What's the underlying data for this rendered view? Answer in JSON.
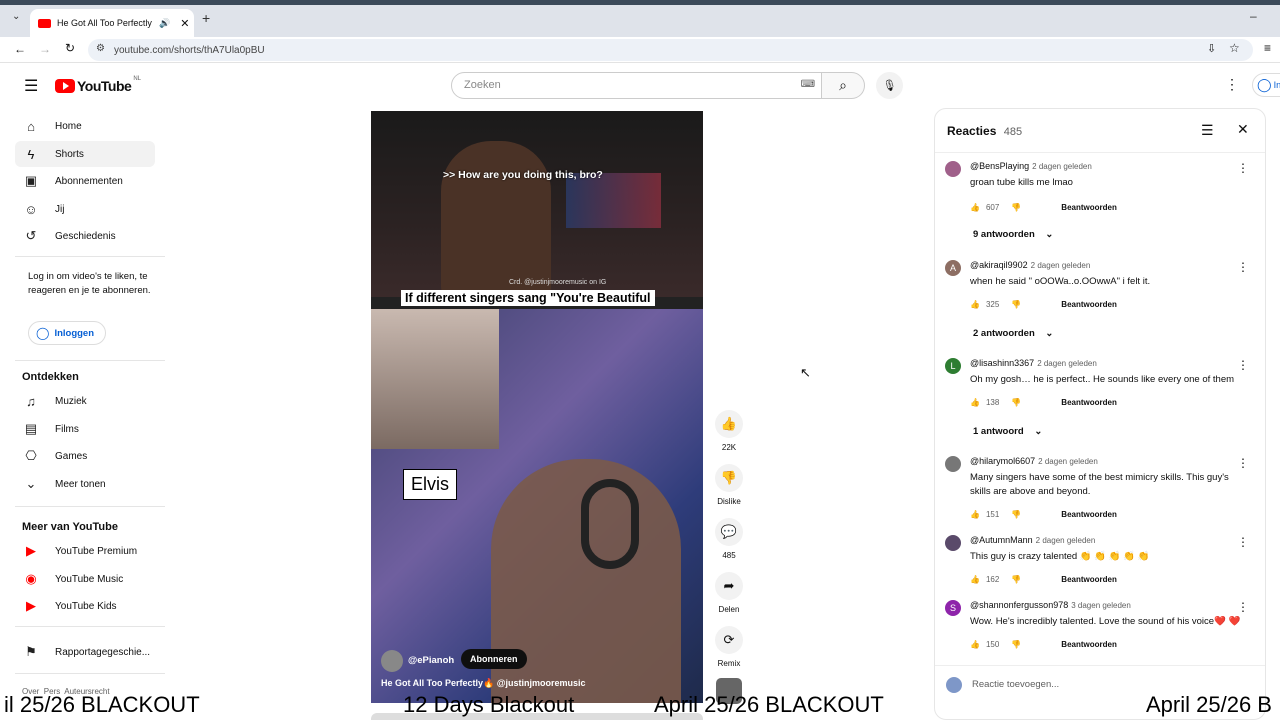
{
  "browser": {
    "tab_title": "He Got All Too Perfectly🔥",
    "url": "youtube.com/shorts/thA7Ula0pBU"
  },
  "header": {
    "logo_text": "YouTube",
    "logo_region": "NL",
    "search_placeholder": "Zoeken",
    "signin_partial": "In"
  },
  "sidebar": {
    "main": [
      {
        "label": "Home",
        "icon": "home-icon"
      },
      {
        "label": "Shorts",
        "icon": "shorts-icon"
      },
      {
        "label": "Abonnementen",
        "icon": "subscriptions-icon"
      },
      {
        "label": "Jij",
        "icon": "you-icon"
      },
      {
        "label": "Geschiedenis",
        "icon": "history-icon"
      }
    ],
    "signin_prompt": "Log in om video's te liken, te reageren en je te abonneren.",
    "signin_button": "Inloggen",
    "explore_heading": "Ontdekken",
    "explore": [
      {
        "label": "Muziek",
        "icon": "music-icon"
      },
      {
        "label": "Films",
        "icon": "films-icon"
      },
      {
        "label": "Games",
        "icon": "games-icon"
      },
      {
        "label": "Meer tonen",
        "icon": "chevron-down-icon"
      }
    ],
    "more_heading": "Meer van YouTube",
    "more": [
      {
        "label": "YouTube Premium"
      },
      {
        "label": "YouTube Music"
      },
      {
        "label": "YouTube Kids"
      }
    ],
    "report": "Rapportagegeschie...",
    "footer": "Over  Pers  Auteursrecht"
  },
  "video": {
    "caption_top": ">> How are you doing this, bro?",
    "credit": "Crd. @justinjmooremusic on IG",
    "banner": "If different singers sang \"You're Beautiful",
    "name_tag": "Elvis",
    "channel": "@ePianoh",
    "subscribe": "Abonneren",
    "title": "He Got All Too Perfectly🔥 @justinjmooremusic"
  },
  "actions": {
    "like_count": "22K",
    "dislike_label": "Dislike",
    "comment_count": "485",
    "share_label": "Delen",
    "remix_label": "Remix"
  },
  "comments": {
    "title": "Reacties",
    "count": "485",
    "reply_label": "Beantwoorden",
    "add_placeholder": "Reactie toevoegen...",
    "items": [
      {
        "user": "@BensPlaying",
        "time": "2 dagen geleden",
        "text": "groan tube kills me lmao",
        "likes": "607",
        "avatar": "",
        "color": "#a0608a"
      },
      {
        "user": "@akiraqil9902",
        "time": "2 dagen geleden",
        "text": "when he said \" oOOWa..o.OOwwA\" i felt it.",
        "likes": "325",
        "avatar": "A",
        "color": "#8d6e63"
      },
      {
        "user": "@lisashinn3367",
        "time": "2 dagen geleden",
        "text": "Oh my gosh… he is perfect.. He sounds like every one of them",
        "likes": "138",
        "avatar": "L",
        "color": "#2e7d32"
      },
      {
        "user": "@hilarymol6607",
        "time": "2 dagen geleden",
        "text": "Many singers have some of the best mimicry skills. This guy's skills are above and beyond.",
        "likes": "151",
        "avatar": "",
        "color": "#777777"
      },
      {
        "user": "@AutumnMann",
        "time": "2 dagen geleden",
        "text": "This guy is crazy talented 👏 👏 👏 👏 👏",
        "likes": "162",
        "avatar": "",
        "color": "#5a4a6a"
      },
      {
        "user": "@shannonfergusson978",
        "time": "3 dagen geleden",
        "text": "Wow. He's incredibly talented. Love the sound of his voice❤️ ❤️",
        "likes": "150",
        "avatar": "S",
        "color": "#8e24aa"
      }
    ],
    "replies": [
      "9 antwoorden",
      "2 antwoorden",
      "1 antwoord"
    ]
  },
  "ticker": {
    "t1": "il 25/26 BLACKOUT",
    "t2": "12 Days Blackout",
    "t3": "April 25/26 BLACKOUT",
    "t4": "April 25/26 B"
  },
  "colors": {
    "yt_red": "#ff0000",
    "link_blue": "#065fd4"
  }
}
